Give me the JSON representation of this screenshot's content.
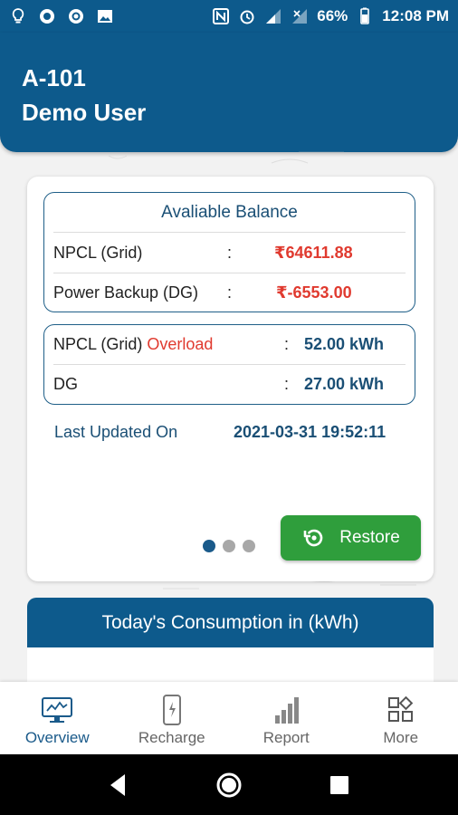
{
  "status_bar": {
    "battery": "66%",
    "time": "12:08 PM"
  },
  "header": {
    "unit": "A-101",
    "user": "Demo User"
  },
  "balance": {
    "title": "Avaliable Balance",
    "rows": [
      {
        "label": "NPCL (Grid)",
        "colon": ":",
        "value": "₹64611.88"
      },
      {
        "label": "Power Backup (DG)",
        "colon": ":",
        "value": "₹-6553.00"
      }
    ]
  },
  "load": {
    "rows": [
      {
        "label": "NPCL (Grid)",
        "status": "Overload",
        "colon": ":",
        "value": "52.00 kWh"
      },
      {
        "label": "DG",
        "colon": ":",
        "value": "27.00 kWh"
      }
    ]
  },
  "last_updated": {
    "label": "Last Updated On",
    "value": "2021-03-31 19:52:11"
  },
  "pager": {
    "count": 3,
    "active": 1
  },
  "restore_button": {
    "label": "Restore"
  },
  "consumption": {
    "title": "Today's Consumption in (kWh)"
  },
  "bottom_nav": {
    "items": [
      {
        "label": "Overview",
        "icon": "overview-monitor-icon",
        "active": true
      },
      {
        "label": "Recharge",
        "icon": "phone-recharge-icon"
      },
      {
        "label": "Report",
        "icon": "bar-chart-icon"
      },
      {
        "label": "More",
        "icon": "grid-more-icon"
      }
    ]
  },
  "colors": {
    "primary": "#0d5a8c",
    "accent_green": "#2f9e3c",
    "negative_red": "#e03a2f",
    "value_blue": "#1a4f75"
  }
}
